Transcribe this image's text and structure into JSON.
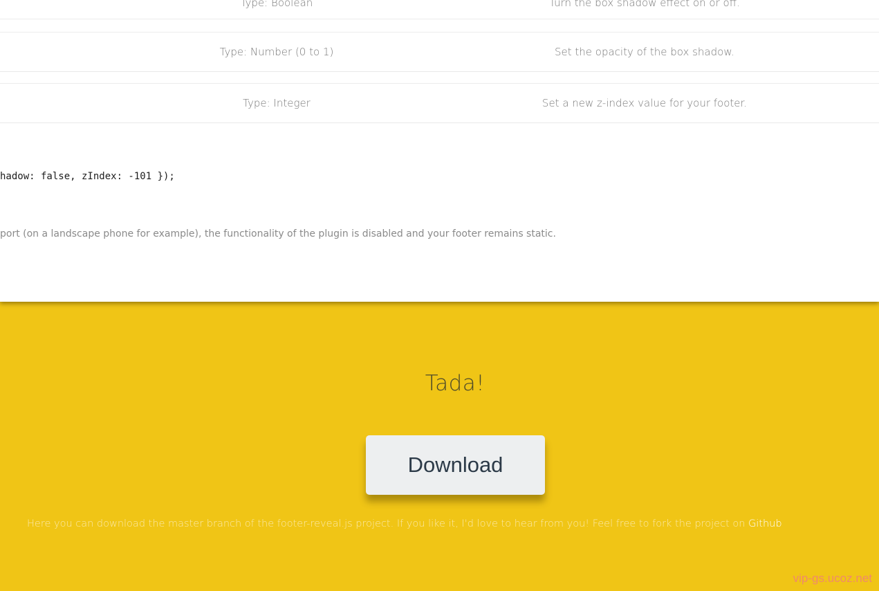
{
  "options_table": {
    "rows": [
      {
        "type": "Type: Boolean",
        "description": "Turn the box shadow effect on or off."
      },
      {
        "type": "Type: Number (0 to 1)",
        "description": "Set the opacity of the box shadow."
      },
      {
        "type": "Type: Integer",
        "description": "Set a new z-index value for your footer."
      }
    ]
  },
  "code_example": "hadow: false, zIndex: -101 });",
  "note": "port (on a landscape phone for example), the functionality of the plugin is disabled and your footer remains static.",
  "footer": {
    "heading": "Tada!",
    "download_label": "Download",
    "text": "Here you can download the master branch of the footer-reveal.js project. If you like it, I'd love to hear from you! Feel free to fork the project on ",
    "github_link": "Github",
    "watermark": "vip-gs.ucoz.net"
  },
  "colors": {
    "footer_bg": "#f0c516",
    "button_bg": "#edeff0",
    "button_text": "#2c3a48",
    "link": "#ffffff"
  }
}
